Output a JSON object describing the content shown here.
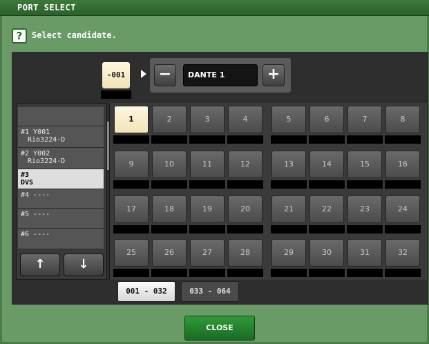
{
  "window": {
    "title": "PORT SELECT"
  },
  "prompt": {
    "icon": "help-icon",
    "text": "Select candidate."
  },
  "current_port": {
    "number": "-001"
  },
  "selector": {
    "minus_label": "−",
    "plus_label": "+",
    "value": "DANTE 1"
  },
  "device_list": [
    {
      "line1": "",
      "line2": ""
    },
    {
      "line1": "#1 Y001",
      "line2": "Rio3224-D"
    },
    {
      "line1": "#2 Y002",
      "line2": "Rio3224-D"
    },
    {
      "line1": "#3",
      "line2": "DVS"
    },
    {
      "line1": "#4 ----",
      "line2": ""
    },
    {
      "line1": "#5 ----",
      "line2": ""
    },
    {
      "line1": "#6 ----",
      "line2": ""
    }
  ],
  "selected_device": 3,
  "list_nav": {
    "up_label": "↑",
    "down_label": "↓"
  },
  "ports": [
    "1",
    "2",
    "3",
    "4",
    "5",
    "6",
    "7",
    "8",
    "9",
    "10",
    "11",
    "12",
    "13",
    "14",
    "15",
    "16",
    "17",
    "18",
    "19",
    "20",
    "21",
    "22",
    "23",
    "24",
    "25",
    "26",
    "27",
    "28",
    "29",
    "30",
    "31",
    "32"
  ],
  "selected_port": "1",
  "range_tabs": [
    "001 - 032",
    "033 - 064"
  ],
  "active_range": 0,
  "close_label": "CLOSE",
  "colors": {
    "accent": "#2f9a3a",
    "selected": "#fff8e2",
    "background": "#6a9a66"
  }
}
